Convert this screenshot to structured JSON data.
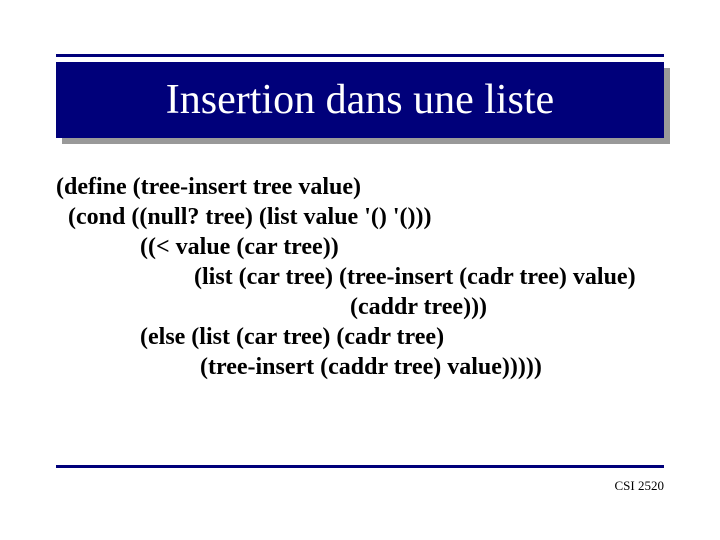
{
  "title": "Insertion dans une liste",
  "code": {
    "l1a": "(define ",
    "l1b": "(tree-insert tree value)",
    "l2": "  (cond ((null? tree) (list value '() '()))",
    "l3": "              ((< value (car tree))",
    "l4": "                       (list (car tree) (tree-insert (cadr tree) value)",
    "l5": "                                                 (caddr tree)))",
    "l6": "              (else (list (car tree) (cadr tree)",
    "l7": "                        (tree-insert (caddr tree) value)))))"
  },
  "footer": "CSI 2520"
}
